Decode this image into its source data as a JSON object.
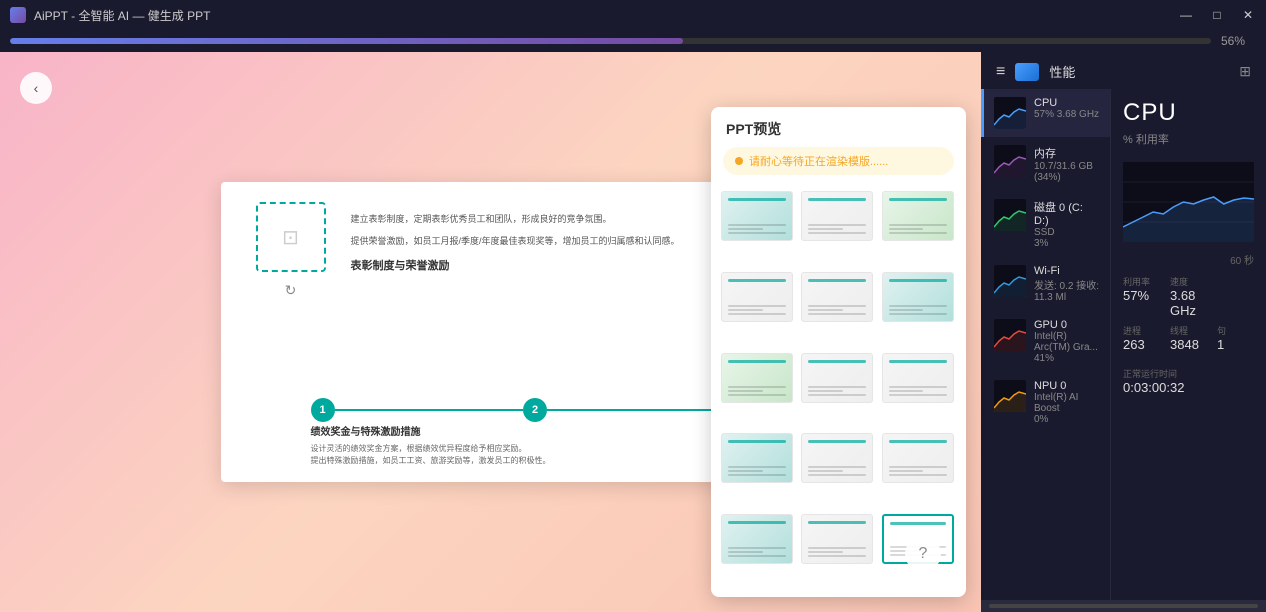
{
  "titleBar": {
    "icon": "A",
    "text": "AiPPT - 全智能 AI — 健生成 PPT",
    "minimizeLabel": "—",
    "maximizeLabel": "□",
    "closeLabel": "✕"
  },
  "progressBar": {
    "percent": 56,
    "percentLabel": "56%",
    "fillWidth": "56%"
  },
  "editor": {
    "backButton": "‹",
    "helpButton": "?",
    "slide": {
      "sectionTitle": "表彰制度与荣誉激励",
      "textBlock1": "建立表彰制度，定期表彰优秀员工和团队，形成良好的竞争氛围。",
      "textBlock2": "提供荣誉激励，如员工月报/季度/年度最佳表现奖等，增加员工的归属感和认同感。",
      "subTitle": "绩效奖金与特殊激励措施",
      "subText1": "设计灵活的绩效奖金方案，根据绩效优异程度给予相应奖励。",
      "subText2": "提出特殊激励措施，如员工工资、旅游奖励等，激发员工的积极性。",
      "timeline": {
        "node1": "1",
        "node2": "2"
      }
    }
  },
  "pptPreview": {
    "title": "PPT预览",
    "renderingMsg": "请耐心等待正在渲染模版......",
    "thumbnails": [
      {
        "id": 1,
        "style": "thumb-teal",
        "selected": false
      },
      {
        "id": 2,
        "style": "thumb-light",
        "selected": false
      },
      {
        "id": 3,
        "style": "thumb-green",
        "selected": false
      },
      {
        "id": 4,
        "style": "thumb-light",
        "selected": false
      },
      {
        "id": 5,
        "style": "thumb-light",
        "selected": false
      },
      {
        "id": 6,
        "style": "thumb-teal",
        "selected": false
      },
      {
        "id": 7,
        "style": "thumb-green",
        "selected": false
      },
      {
        "id": 8,
        "style": "thumb-light",
        "selected": false
      },
      {
        "id": 9,
        "style": "thumb-light",
        "selected": false
      },
      {
        "id": 10,
        "style": "thumb-teal",
        "selected": false
      },
      {
        "id": 11,
        "style": "thumb-light",
        "selected": false
      },
      {
        "id": 12,
        "style": "thumb-light",
        "selected": false
      },
      {
        "id": 13,
        "style": "thumb-teal",
        "selected": false
      },
      {
        "id": 14,
        "style": "thumb-light",
        "selected": false
      },
      {
        "id": 15,
        "style": "thumb-white selected",
        "selected": true
      }
    ]
  },
  "performance": {
    "panelTitle": "性能",
    "expandIcon": "⊞",
    "components": [
      {
        "id": "cpu",
        "name": "CPU",
        "detail": "57%  3.68 GHz",
        "accentColor": "#4a9eff",
        "active": true
      },
      {
        "id": "memory",
        "name": "内存",
        "detail": "10.7/31.6 GB (34%)",
        "accentColor": "#9b59b6",
        "active": false
      },
      {
        "id": "disk",
        "name": "磁盘 0 (C: D:)",
        "detail": "SSD\n3%",
        "accentColor": "#2ecc71",
        "active": false
      },
      {
        "id": "wifi",
        "name": "Wi-Fi",
        "detail": "发送: 0.2  接收: 11.3 Ml",
        "accentColor": "#3498db",
        "active": false
      },
      {
        "id": "gpu",
        "name": "GPU 0",
        "detail": "Intel(R) Arc(TM) Gra...\n41%",
        "accentColor": "#e74c3c",
        "active": false
      },
      {
        "id": "npu",
        "name": "NPU 0",
        "detail": "Intel(R) AI Boost\n0%",
        "accentColor": "#f39c12",
        "active": false
      }
    ],
    "cpuDetail": {
      "title": "CPU",
      "subtitle": "% 利用率",
      "stats": {
        "utilizationLabel": "利用率",
        "utilizationValue": "57%",
        "speedLabel": "速度",
        "speedValue": "3.68 GHz",
        "processLabel": "进程",
        "processValue": "263",
        "threadLabel": "线程",
        "threadValue": "3848",
        "handleLabel": "句",
        "handleValue": "1",
        "uptimeLabel": "正常运行时间",
        "uptimeValue": "0:03:00:32",
        "secondsLabel": "60 秒"
      }
    }
  }
}
